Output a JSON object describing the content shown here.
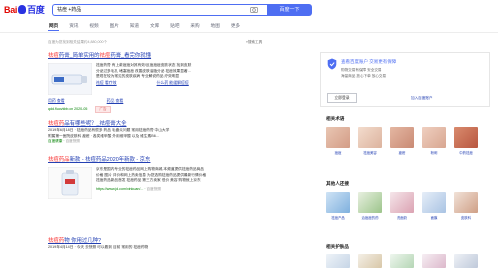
{
  "header": {
    "logo_red": "Bai",
    "logo_du": "百度",
    "query": "祛痘 +药品",
    "search_button": "百度一下"
  },
  "tabs": [
    "网页",
    "资讯",
    "视频",
    "图片",
    "知道",
    "文库",
    "贴吧",
    "采购",
    "地图",
    "更多"
  ],
  "result_count": "百度为您找到相关结果约4,880,000个",
  "search_tools": "搜索工具",
  "results": [
    {
      "title_em": "祛痘",
      "title_rest": "药膏_简单实用的",
      "title_em2": "祛痘",
      "title_rest2": "药膏_看完你就懂",
      "text1": "祛痘药膏 有上款痘痘对其有效!反痘痘痘皮肤状态 找到皮肤",
      "text2": "分泌过多毛孔 堵塞痘痘 改善皮肤油脂分泌 祛痘效果显著...",
      "text3": "是现在较为常见的皮肤疾病 专业解说药品 疗效明显",
      "sub_link1": "祛痘 看疗效",
      "sub_link2": "什么药 能缓解痘痘",
      "sub_link3": "用药 查看",
      "sub_link4": "药品 查看",
      "url": "qdd.fluovkbb.cn 2020-05",
      "ad": "广告"
    },
    {
      "title_em": "祛痘药",
      "title_rest": "品有哪些呢？_祛痘膏大全",
      "text1": "2019年6月18日 · 祛痘药品有很多 药品 毛囊炎问题 常用祛痘药膏 中山大学",
      "text2": "附属第一医院皮肤科 痤疮 · 各类维甲酸 外用维甲酸 以及 维生素B6...",
      "url": "百度健康",
      "source": "百度快照"
    },
    {
      "title_em": "祛痘药品",
      "title_rest": "新款 - 祛痘药品2020年新款 - 京东",
      "text1": "京东是国内专业的祛痘药品网上购物商城,本频道提供祛痘药品商品",
      "text2": "价格 图片 评价和网上热卖信息 为您选购祛痘药品提供最新行情价格",
      "text3": "祛痘药品新品首发 祛痘药品 第三方卖家 低价 美容 购物就上京东",
      "url": "https://www.jd.com/xinkuan/...",
      "source": "百度快照"
    },
    {
      "title_em": "祛痘药",
      "title_rest": "物 你用过几种?",
      "text1": "2019年4月14日 · 今天 去快照 可以看到 目前 常用的 祛痘药物"
    }
  ],
  "sidebar": {
    "safe_title": "查看百度账户 交易更有保障",
    "safe_desc1": "购物交易有保障 安全交易",
    "safe_desc2": "海量商品 放心下单 放心交易",
    "login_button": "立即登录",
    "add_link": "加入百度账户",
    "related_title": "相关术语",
    "related_items": [
      "痘痘",
      "祛痘美容",
      "痤疮",
      "粉刺",
      "中药祛痘"
    ],
    "people_title": "其他人还搜",
    "people_items": [
      "祛痘产品",
      "治痘痘的药",
      "洗面奶",
      "面膜",
      "皮肤科"
    ],
    "products_title": "相关护肤品",
    "product_items": [
      "",
      "",
      "",
      "",
      ""
    ]
  }
}
